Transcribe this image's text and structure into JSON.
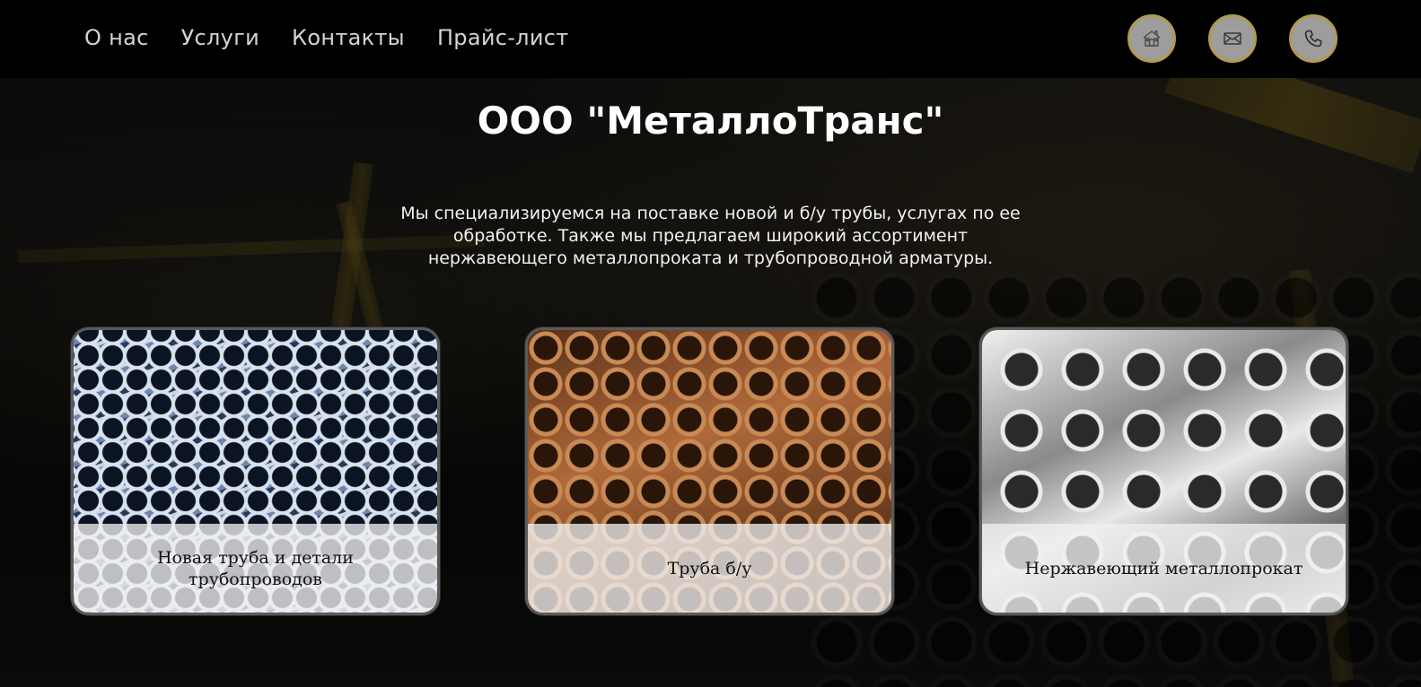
{
  "nav": {
    "items": [
      {
        "label": "О нас"
      },
      {
        "label": "Услуги"
      },
      {
        "label": "Контакты"
      },
      {
        "label": "Прайс-лист"
      }
    ]
  },
  "header_icons": [
    {
      "icon": "home-icon"
    },
    {
      "icon": "mail-icon"
    },
    {
      "icon": "phone-icon"
    }
  ],
  "hero": {
    "title": "ООО \"МеталлоТранс\"",
    "description": "Мы специализируемся на поставке новой и б/у трубы, услугах по ее обработке. Также мы предлагаем широкий ассортимент нержавеющего металлопроката и трубопроводной арматуры."
  },
  "cards": [
    {
      "caption": "Новая труба и детали трубопроводов"
    },
    {
      "caption": "Труба б/у"
    },
    {
      "caption": "Нержавеющий металлопрокат"
    }
  ],
  "colors": {
    "header_bg": "#000000",
    "icon_border": "#b39a4d",
    "icon_fill": "#9d9d9d",
    "nav_text": "#d4d4d4"
  }
}
